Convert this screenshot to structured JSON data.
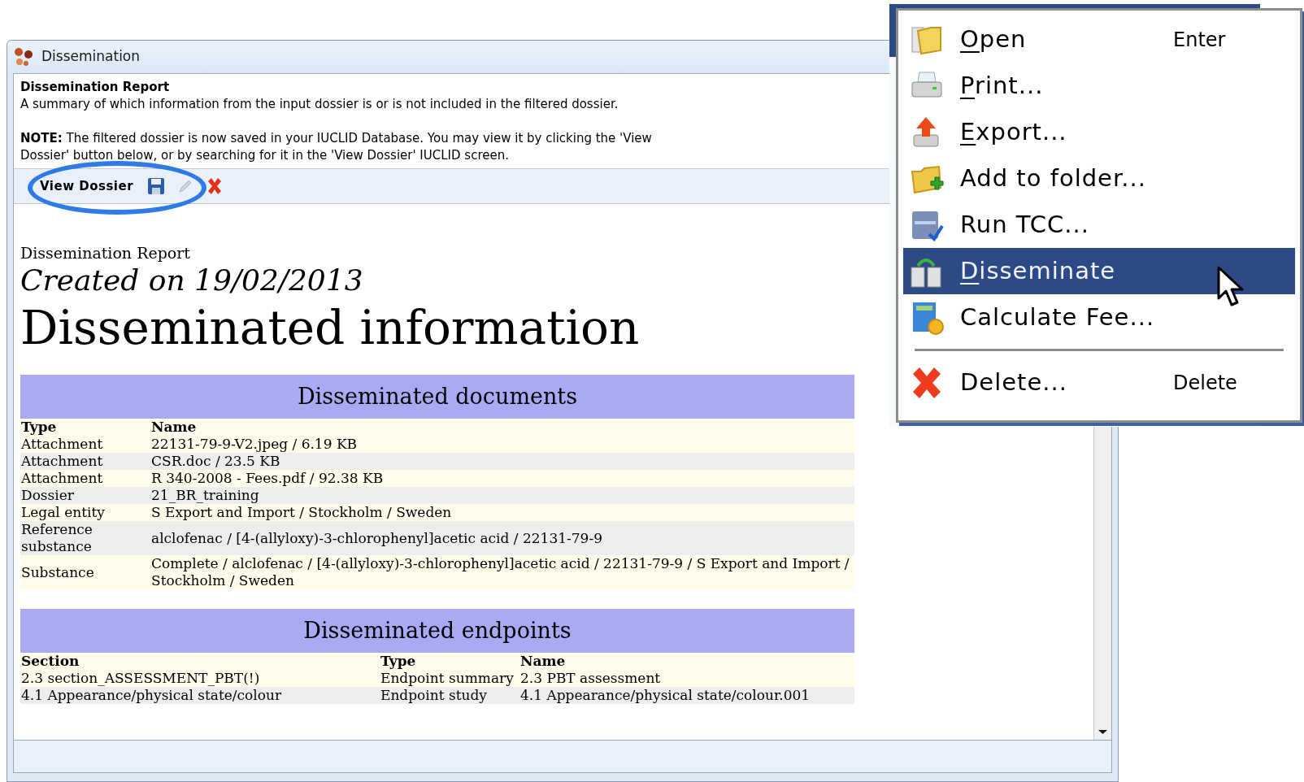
{
  "window": {
    "title": "Dissemination"
  },
  "header": {
    "title": "Dissemination Report",
    "description": "A summary of which information from the input dossier is or is not included in the filtered dossier.",
    "note": "**NOTE:** The filtered dossier is now saved in your IUCLID Database. You may view it by clicking the 'View Dossier' button below, or by searching for it in the 'View Dossier' IUCLID screen."
  },
  "toolbar": [
    {
      "kind": "button",
      "label": "View Dossier",
      "annotated": true
    },
    {
      "kind": "save",
      "disabled": false
    },
    {
      "kind": "edit",
      "disabled": true
    },
    {
      "kind": "delete",
      "disabled": false
    }
  ],
  "report": {
    "label": "Dissemination Report",
    "created": "Created on 19/02/2013",
    "heading": "Disseminated information"
  },
  "documents": {
    "title": "Disseminated documents",
    "columns": [
      "Type",
      "Name"
    ],
    "rows": [
      [
        "Attachment",
        "22131-79-9-V2.jpeg / 6.19 KB"
      ],
      [
        "Attachment",
        "CSR.doc / 23.5 KB"
      ],
      [
        "Attachment",
        "R 340-2008 - Fees.pdf / 92.38 KB"
      ],
      [
        "Dossier",
        "21_BR_training"
      ],
      [
        "Legal entity",
        "S Export and Import / Stockholm / Sweden"
      ],
      [
        "Reference substance",
        "alclofenac / [4-(allyloxy)-3-chlorophenyl]acetic acid / 22131-79-9"
      ],
      [
        "Substance",
        "Complete / alclofenac / [4-(allyloxy)-3-chlorophenyl]acetic acid / 22131-79-9 / S Export and Import / Stockholm / Sweden"
      ]
    ]
  },
  "endpoints": {
    "title": "Disseminated endpoints",
    "columns": [
      "Section",
      "Type",
      "Name"
    ],
    "rows": [
      [
        "2.3 section_ASSESSMENT_PBT(!)",
        "Endpoint summary",
        "2.3 PBT assessment"
      ],
      [
        "4.1 Appearance/physical state/colour",
        "Endpoint study",
        "4.1 Appearance/physical state/colour.001"
      ]
    ]
  },
  "context_menu": {
    "items": [
      {
        "kind": "item",
        "label": "Open",
        "shortcut": "Enter",
        "underline_first": true,
        "selected": false
      },
      {
        "kind": "item",
        "label": "Print...",
        "underline_first": true,
        "selected": false
      },
      {
        "kind": "item",
        "label": "Export...",
        "underline_first": true,
        "selected": false
      },
      {
        "kind": "item",
        "label": "Add to folder...",
        "underline_first": false,
        "selected": false
      },
      {
        "kind": "item",
        "label": "Run TCC...",
        "underline_first": false,
        "selected": false
      },
      {
        "kind": "item",
        "label": "Disseminate",
        "underline_first": true,
        "selected": true
      },
      {
        "kind": "item",
        "label": "Calculate Fee...",
        "underline_first": false,
        "selected": false
      },
      {
        "kind": "separator"
      },
      {
        "kind": "item",
        "label": "Delete...",
        "shortcut": "Delete",
        "underline_first": false,
        "selected": false
      }
    ]
  }
}
